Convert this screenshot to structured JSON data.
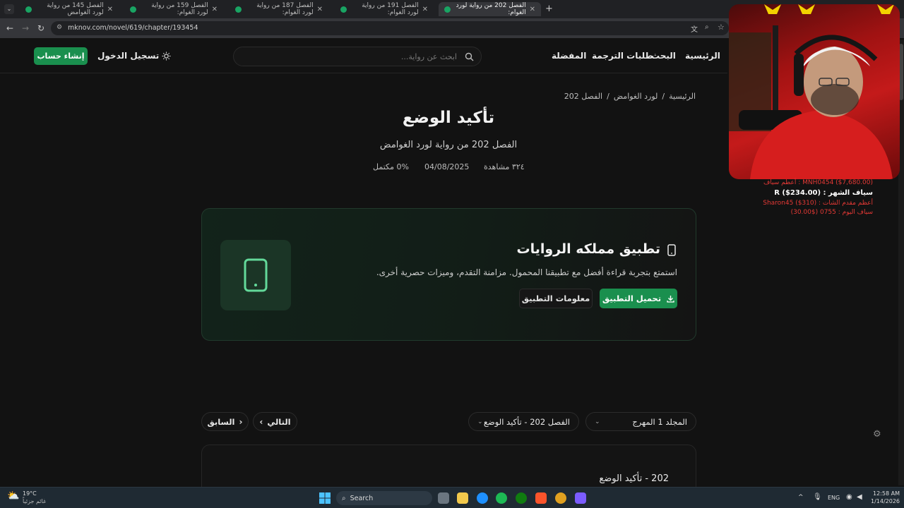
{
  "browser": {
    "tabs": [
      {
        "label": "الفصل 145 من رواية لورد الغوامض",
        "active": false
      },
      {
        "label": "الفصل 159 من رواية لورد الغوام:",
        "active": false
      },
      {
        "label": "الفصل 187 من رواية لورد الغوام:",
        "active": false
      },
      {
        "label": "الفصل 191 من رواية لورد الغوام:",
        "active": false
      },
      {
        "label": "الفصل 202 من رواية لورد الغوام:",
        "active": true
      }
    ],
    "new_tab": "+",
    "url": "mknov.com/novel/619/chapter/193454"
  },
  "header": {
    "nav": {
      "home": "الرئيسية",
      "search": "البحث",
      "translation_requests": "طلبات الترجمة",
      "favorites": "المفضلة"
    },
    "search_placeholder": "ابحث عن رواية...",
    "login": "تسجيل الدخول",
    "signup": "إنشاء حساب"
  },
  "breadcrumb": {
    "home": "الرئيسية",
    "sep": "/",
    "novel": "لورد الغوامض",
    "chapter": "الفصل 202"
  },
  "chapter": {
    "title": "تأكيد الوضع",
    "subtitle": "الفصل 202 من رواية لورد الغوامض",
    "views": "٣٢٤ مشاهدة",
    "date": "04/08/2025",
    "progress": "0% مكتمل"
  },
  "promo": {
    "title": "تطبيق مملكه الروايات",
    "description": "استمتع بتجربة قراءة أفضل مع تطبيقنا المحمول. مزامنة التقدم، وميزات حصرية أخرى.",
    "download_label": "تحميل التطبيق",
    "info_label": "معلومات التطبيق"
  },
  "chapter_nav": {
    "volume_select": "المجلد 1 المهرج",
    "chapter_select": "الفصل 202 - تأكيد الوضع",
    "next_label": "التالي",
    "prev_label": "السابق"
  },
  "content": {
    "heading": "202 - تأكيد الوضع"
  },
  "overlay": {
    "top_donor": "MNH0454 ($7,680.00) : أعظم سياف",
    "month_donor": "سياف الشهر : R ($234.00)",
    "line3": "أعظم مقدم الشات : Sharon45 ($310)",
    "line4": "سياف اليوم : 0755 ($30.00)"
  },
  "taskbar": {
    "weather_temp": "19°C",
    "weather_desc": "غائم جزئياً",
    "search_label": "Search",
    "lang": "ENG",
    "time": "12:58 AM",
    "date": "1/14/2026"
  },
  "colors": {
    "accent_green": "#1a8f4e",
    "background": "#121212"
  }
}
